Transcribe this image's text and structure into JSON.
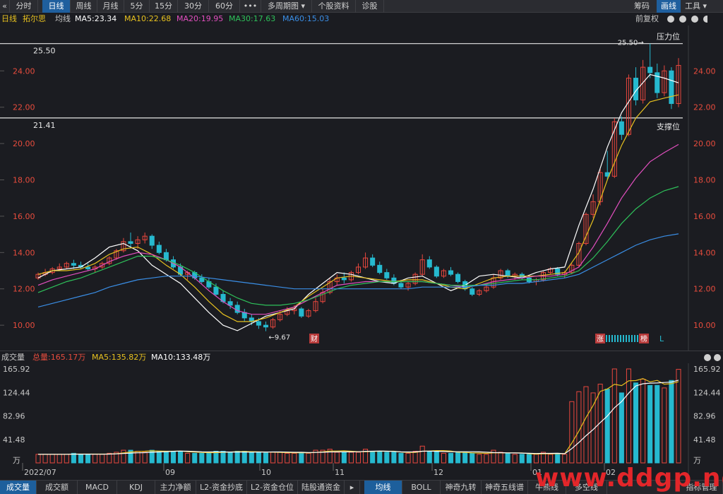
{
  "toolbar": {
    "back_icon": "«",
    "tabs": [
      {
        "label": "分时",
        "active": false
      },
      {
        "label": "日线",
        "active": true
      },
      {
        "label": "周线",
        "active": false
      },
      {
        "label": "月线",
        "active": false
      },
      {
        "label": "5分",
        "active": false
      },
      {
        "label": "15分",
        "active": false
      },
      {
        "label": "30分",
        "active": false
      },
      {
        "label": "60分",
        "active": false
      },
      {
        "label": "•••",
        "active": false
      },
      {
        "label": "多周期图 ▾",
        "active": false
      },
      {
        "label": "个股资料",
        "active": false
      },
      {
        "label": "诊股",
        "active": false
      }
    ],
    "right": {
      "chips": "筹码",
      "draw": "画线",
      "tools": "工具 ▾"
    }
  },
  "info": {
    "period": "日线",
    "stock_name": "拓尔思",
    "ma_label": "均线",
    "ma5": "MA5:23.34",
    "ma10": "MA10:22.68",
    "ma20": "MA20:19.95",
    "ma30": "MA30:17.63",
    "ma60": "MA60:15.03",
    "fq": "前复权"
  },
  "colors": {
    "bg": "#1b1c21",
    "up": "#e8473e",
    "down": "#26b9cf",
    "ma5": "#ffffff",
    "ma10": "#e7c11f",
    "ma20": "#e24fbf",
    "ma30": "#2ec15a",
    "ma60": "#3a8ee6",
    "axis_text": "#e84c3d"
  },
  "chart_data": {
    "type": "candlestick",
    "price_axis": {
      "ticks": [
        "24.00",
        "22.00",
        "20.00",
        "18.00",
        "16.00",
        "14.00",
        "12.00",
        "10.00"
      ],
      "min": 8.8,
      "max": 26.5
    },
    "levels": [
      {
        "value": 25.5,
        "label": "25.50",
        "name": "压力位"
      },
      {
        "value": 21.41,
        "label": "21.41",
        "name": "支撑位"
      }
    ],
    "annotations": {
      "low": "9.67",
      "high": "25.50"
    },
    "markers": [
      "财",
      "涨",
      "榜",
      "L"
    ],
    "x_labels": [
      "2022/07",
      "09",
      "10",
      "11",
      "12",
      "01",
      "02"
    ],
    "candles_ohlc": [
      [
        12.6,
        12.9,
        12.5,
        12.8
      ],
      [
        12.8,
        13.1,
        12.7,
        12.9
      ],
      [
        12.9,
        13.2,
        12.8,
        13.1
      ],
      [
        13.1,
        13.4,
        13.0,
        13.2
      ],
      [
        13.2,
        13.5,
        13.1,
        13.4
      ],
      [
        13.4,
        13.6,
        13.1,
        13.3
      ],
      [
        13.3,
        13.5,
        13.1,
        13.2
      ],
      [
        13.2,
        13.4,
        13.0,
        13.1
      ],
      [
        13.1,
        13.3,
        12.9,
        13.2
      ],
      [
        13.2,
        13.5,
        13.1,
        13.4
      ],
      [
        13.4,
        13.8,
        13.3,
        13.7
      ],
      [
        13.7,
        14.2,
        13.6,
        14.1
      ],
      [
        14.1,
        14.8,
        14.0,
        14.6
      ],
      [
        14.6,
        15.1,
        14.3,
        14.5
      ],
      [
        14.5,
        14.9,
        14.2,
        14.7
      ],
      [
        14.7,
        15.1,
        14.5,
        14.9
      ],
      [
        14.9,
        15.0,
        14.2,
        14.4
      ],
      [
        14.4,
        14.6,
        13.9,
        14.0
      ],
      [
        14.0,
        14.2,
        13.5,
        13.6
      ],
      [
        13.6,
        13.8,
        13.1,
        13.2
      ],
      [
        13.2,
        13.4,
        12.7,
        12.8
      ],
      [
        12.8,
        13.0,
        12.5,
        12.9
      ],
      [
        12.9,
        13.0,
        12.5,
        12.6
      ],
      [
        12.6,
        12.8,
        12.3,
        12.4
      ],
      [
        12.4,
        12.6,
        12.0,
        12.1
      ],
      [
        12.1,
        12.3,
        11.6,
        11.7
      ],
      [
        11.7,
        11.9,
        11.2,
        11.3
      ],
      [
        11.3,
        11.5,
        10.9,
        11.1
      ],
      [
        11.1,
        11.3,
        10.6,
        10.7
      ],
      [
        10.7,
        10.9,
        10.2,
        10.4
      ],
      [
        10.4,
        10.6,
        10.0,
        10.2
      ],
      [
        10.2,
        10.4,
        9.8,
        10.0
      ],
      [
        10.0,
        10.2,
        9.67,
        9.9
      ],
      [
        9.9,
        10.4,
        9.8,
        10.3
      ],
      [
        10.3,
        10.8,
        10.2,
        10.6
      ],
      [
        10.6,
        11.0,
        10.5,
        10.8
      ],
      [
        10.8,
        11.1,
        10.6,
        10.9
      ],
      [
        10.9,
        11.0,
        10.4,
        10.5
      ],
      [
        10.5,
        10.9,
        10.4,
        10.8
      ],
      [
        10.8,
        11.5,
        10.7,
        11.3
      ],
      [
        11.3,
        12.0,
        11.2,
        11.8
      ],
      [
        11.8,
        12.6,
        11.7,
        12.4
      ],
      [
        12.4,
        12.8,
        12.2,
        12.6
      ],
      [
        12.6,
        12.9,
        12.3,
        12.5
      ],
      [
        12.5,
        13.0,
        12.4,
        12.9
      ],
      [
        12.9,
        13.4,
        12.8,
        13.2
      ],
      [
        13.2,
        14.0,
        13.1,
        13.7
      ],
      [
        13.7,
        13.9,
        13.2,
        13.3
      ],
      [
        13.3,
        13.5,
        12.8,
        12.9
      ],
      [
        12.9,
        13.1,
        12.5,
        12.6
      ],
      [
        12.6,
        12.8,
        12.2,
        12.3
      ],
      [
        12.3,
        12.5,
        12.0,
        12.1
      ],
      [
        12.1,
        12.4,
        11.9,
        12.3
      ],
      [
        12.3,
        12.9,
        12.2,
        12.8
      ],
      [
        12.8,
        13.9,
        12.7,
        13.6
      ],
      [
        13.6,
        13.8,
        13.1,
        13.2
      ],
      [
        13.2,
        13.3,
        12.6,
        12.7
      ],
      [
        12.7,
        13.1,
        12.6,
        13.0
      ],
      [
        13.0,
        13.2,
        12.7,
        12.8
      ],
      [
        12.8,
        12.9,
        12.3,
        12.4
      ],
      [
        12.4,
        12.5,
        11.9,
        12.0
      ],
      [
        12.0,
        12.1,
        11.6,
        11.7
      ],
      [
        11.7,
        12.0,
        11.6,
        11.9
      ],
      [
        11.9,
        12.2,
        11.8,
        12.1
      ],
      [
        12.1,
        12.8,
        12.0,
        12.6
      ],
      [
        12.6,
        13.1,
        12.5,
        13.0
      ],
      [
        13.0,
        13.1,
        12.6,
        12.7
      ],
      [
        12.7,
        12.9,
        12.5,
        12.8
      ],
      [
        12.8,
        12.9,
        12.5,
        12.6
      ],
      [
        12.6,
        12.7,
        12.3,
        12.4
      ],
      [
        12.4,
        12.6,
        12.2,
        12.5
      ],
      [
        12.5,
        13.0,
        12.4,
        12.9
      ],
      [
        12.9,
        13.2,
        12.8,
        13.1
      ],
      [
        13.1,
        13.2,
        12.7,
        12.8
      ],
      [
        12.8,
        13.0,
        12.6,
        12.9
      ],
      [
        12.9,
        13.4,
        12.8,
        13.3
      ],
      [
        13.3,
        14.6,
        13.2,
        14.5
      ],
      [
        14.5,
        16.2,
        14.4,
        16.1
      ],
      [
        16.1,
        17.2,
        15.9,
        16.8
      ],
      [
        16.8,
        18.6,
        16.6,
        18.4
      ],
      [
        18.4,
        19.6,
        18.0,
        18.2
      ],
      [
        18.2,
        21.4,
        18.1,
        21.2
      ],
      [
        21.2,
        21.5,
        20.2,
        20.5
      ],
      [
        20.5,
        23.8,
        20.4,
        23.6
      ],
      [
        23.6,
        24.2,
        22.1,
        22.4
      ],
      [
        22.4,
        24.6,
        22.2,
        24.2
      ],
      [
        24.2,
        25.5,
        23.6,
        23.9
      ],
      [
        23.9,
        24.4,
        22.5,
        22.8
      ],
      [
        22.8,
        24.3,
        22.6,
        24.0
      ],
      [
        24.0,
        24.2,
        21.9,
        22.2
      ],
      [
        22.2,
        24.7,
        22.0,
        24.3
      ]
    ],
    "ma": {
      "ma5": [
        12.6,
        13.0,
        13.1,
        13.2,
        13.7,
        14.3,
        14.5,
        14.1,
        13.3,
        12.8,
        12.3,
        11.5,
        10.7,
        10.0,
        9.7,
        10.1,
        10.5,
        10.7,
        10.9,
        11.7,
        12.3,
        12.9,
        12.8,
        12.6,
        12.4,
        12.3,
        12.6,
        12.7,
        12.3,
        11.9,
        12.2,
        12.7,
        12.8,
        12.7,
        12.6,
        12.9,
        13.1,
        13.2,
        15.5,
        17.5,
        19.8,
        21.7,
        22.9,
        23.8,
        23.6,
        23.34
      ],
      "ma10": [
        12.8,
        13.0,
        13.0,
        13.1,
        13.4,
        13.9,
        14.2,
        14.3,
        13.9,
        13.3,
        12.8,
        12.1,
        11.3,
        10.6,
        10.2,
        10.2,
        10.4,
        10.7,
        11.0,
        11.6,
        12.1,
        12.6,
        12.7,
        12.6,
        12.5,
        12.4,
        12.5,
        12.5,
        12.3,
        12.1,
        12.0,
        12.3,
        12.6,
        12.7,
        12.7,
        12.7,
        12.8,
        12.9,
        14.0,
        15.8,
        18.0,
        19.9,
        21.4,
        22.3,
        22.5,
        22.68
      ],
      "ma20": [
        12.2,
        12.5,
        12.7,
        12.9,
        13.1,
        13.5,
        13.8,
        14.0,
        13.9,
        13.6,
        13.2,
        12.6,
        11.9,
        11.3,
        10.8,
        10.6,
        10.6,
        10.8,
        11.0,
        11.4,
        11.8,
        12.2,
        12.3,
        12.4,
        12.4,
        12.4,
        12.4,
        12.4,
        12.3,
        12.2,
        12.1,
        12.2,
        12.4,
        12.5,
        12.6,
        12.7,
        12.7,
        12.8,
        13.2,
        14.3,
        15.6,
        17.0,
        18.1,
        19.0,
        19.5,
        19.95
      ],
      "ma30": [
        11.8,
        12.1,
        12.4,
        12.6,
        12.9,
        13.2,
        13.5,
        13.8,
        13.8,
        13.6,
        13.3,
        12.9,
        12.4,
        11.9,
        11.5,
        11.2,
        11.1,
        11.1,
        11.2,
        11.4,
        11.7,
        12.0,
        12.2,
        12.3,
        12.4,
        12.4,
        12.4,
        12.4,
        12.3,
        12.2,
        12.2,
        12.2,
        12.3,
        12.4,
        12.5,
        12.5,
        12.6,
        12.7,
        13.0,
        13.7,
        14.6,
        15.6,
        16.4,
        17.0,
        17.4,
        17.63
      ],
      "ma60": [
        11.0,
        11.2,
        11.4,
        11.6,
        11.8,
        12.1,
        12.3,
        12.5,
        12.6,
        12.7,
        12.7,
        12.7,
        12.6,
        12.5,
        12.4,
        12.3,
        12.2,
        12.1,
        12.0,
        12.0,
        12.0,
        12.0,
        12.0,
        12.0,
        12.0,
        12.0,
        12.0,
        12.1,
        12.1,
        12.1,
        12.1,
        12.2,
        12.2,
        12.3,
        12.3,
        12.4,
        12.5,
        12.6,
        12.8,
        13.2,
        13.6,
        14.0,
        14.4,
        14.7,
        14.9,
        15.03
      ]
    }
  },
  "volume": {
    "title": "成交量",
    "total": "总量:165.17万",
    "ma5": "MA5:135.82万",
    "ma10": "MA10:133.48万",
    "ticks": [
      "165.92",
      "124.44",
      "82.96",
      "41.48"
    ],
    "unit": "万",
    "max": 165.92
  },
  "bottom_tabs": [
    "成交量",
    "成交额",
    "MACD",
    "KDJ",
    "主力净额",
    "L2-资金抄底",
    "L2-资金仓位",
    "陆股通资金",
    "▸",
    "均线",
    "BOLL",
    "神奇九转",
    "神奇五线谱",
    "牛熊线",
    "多空线",
    "指标管理"
  ],
  "watermark": "www.ddgp.net"
}
